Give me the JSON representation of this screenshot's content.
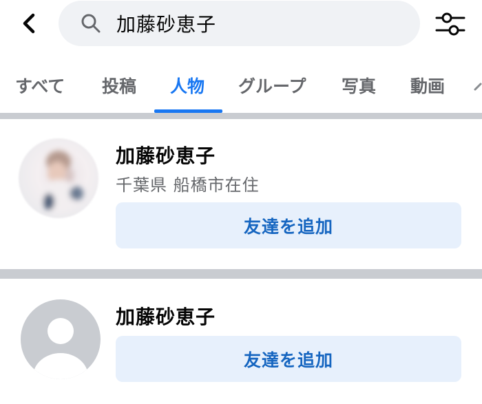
{
  "search": {
    "query": "加藤砂恵子"
  },
  "tabs": [
    "すべて",
    "投稿",
    "人物",
    "グループ",
    "写真",
    "動画"
  ],
  "active_tab": "人物",
  "accent_color": "#1877f2",
  "results": [
    {
      "name": "加藤砂恵子",
      "location": "千葉県 船橋市在住",
      "add_label": "友達を追加",
      "avatar": "profile-photo"
    },
    {
      "name": "加藤砂恵子",
      "add_label": "友達を追加",
      "avatar": "default-silhouette"
    }
  ]
}
